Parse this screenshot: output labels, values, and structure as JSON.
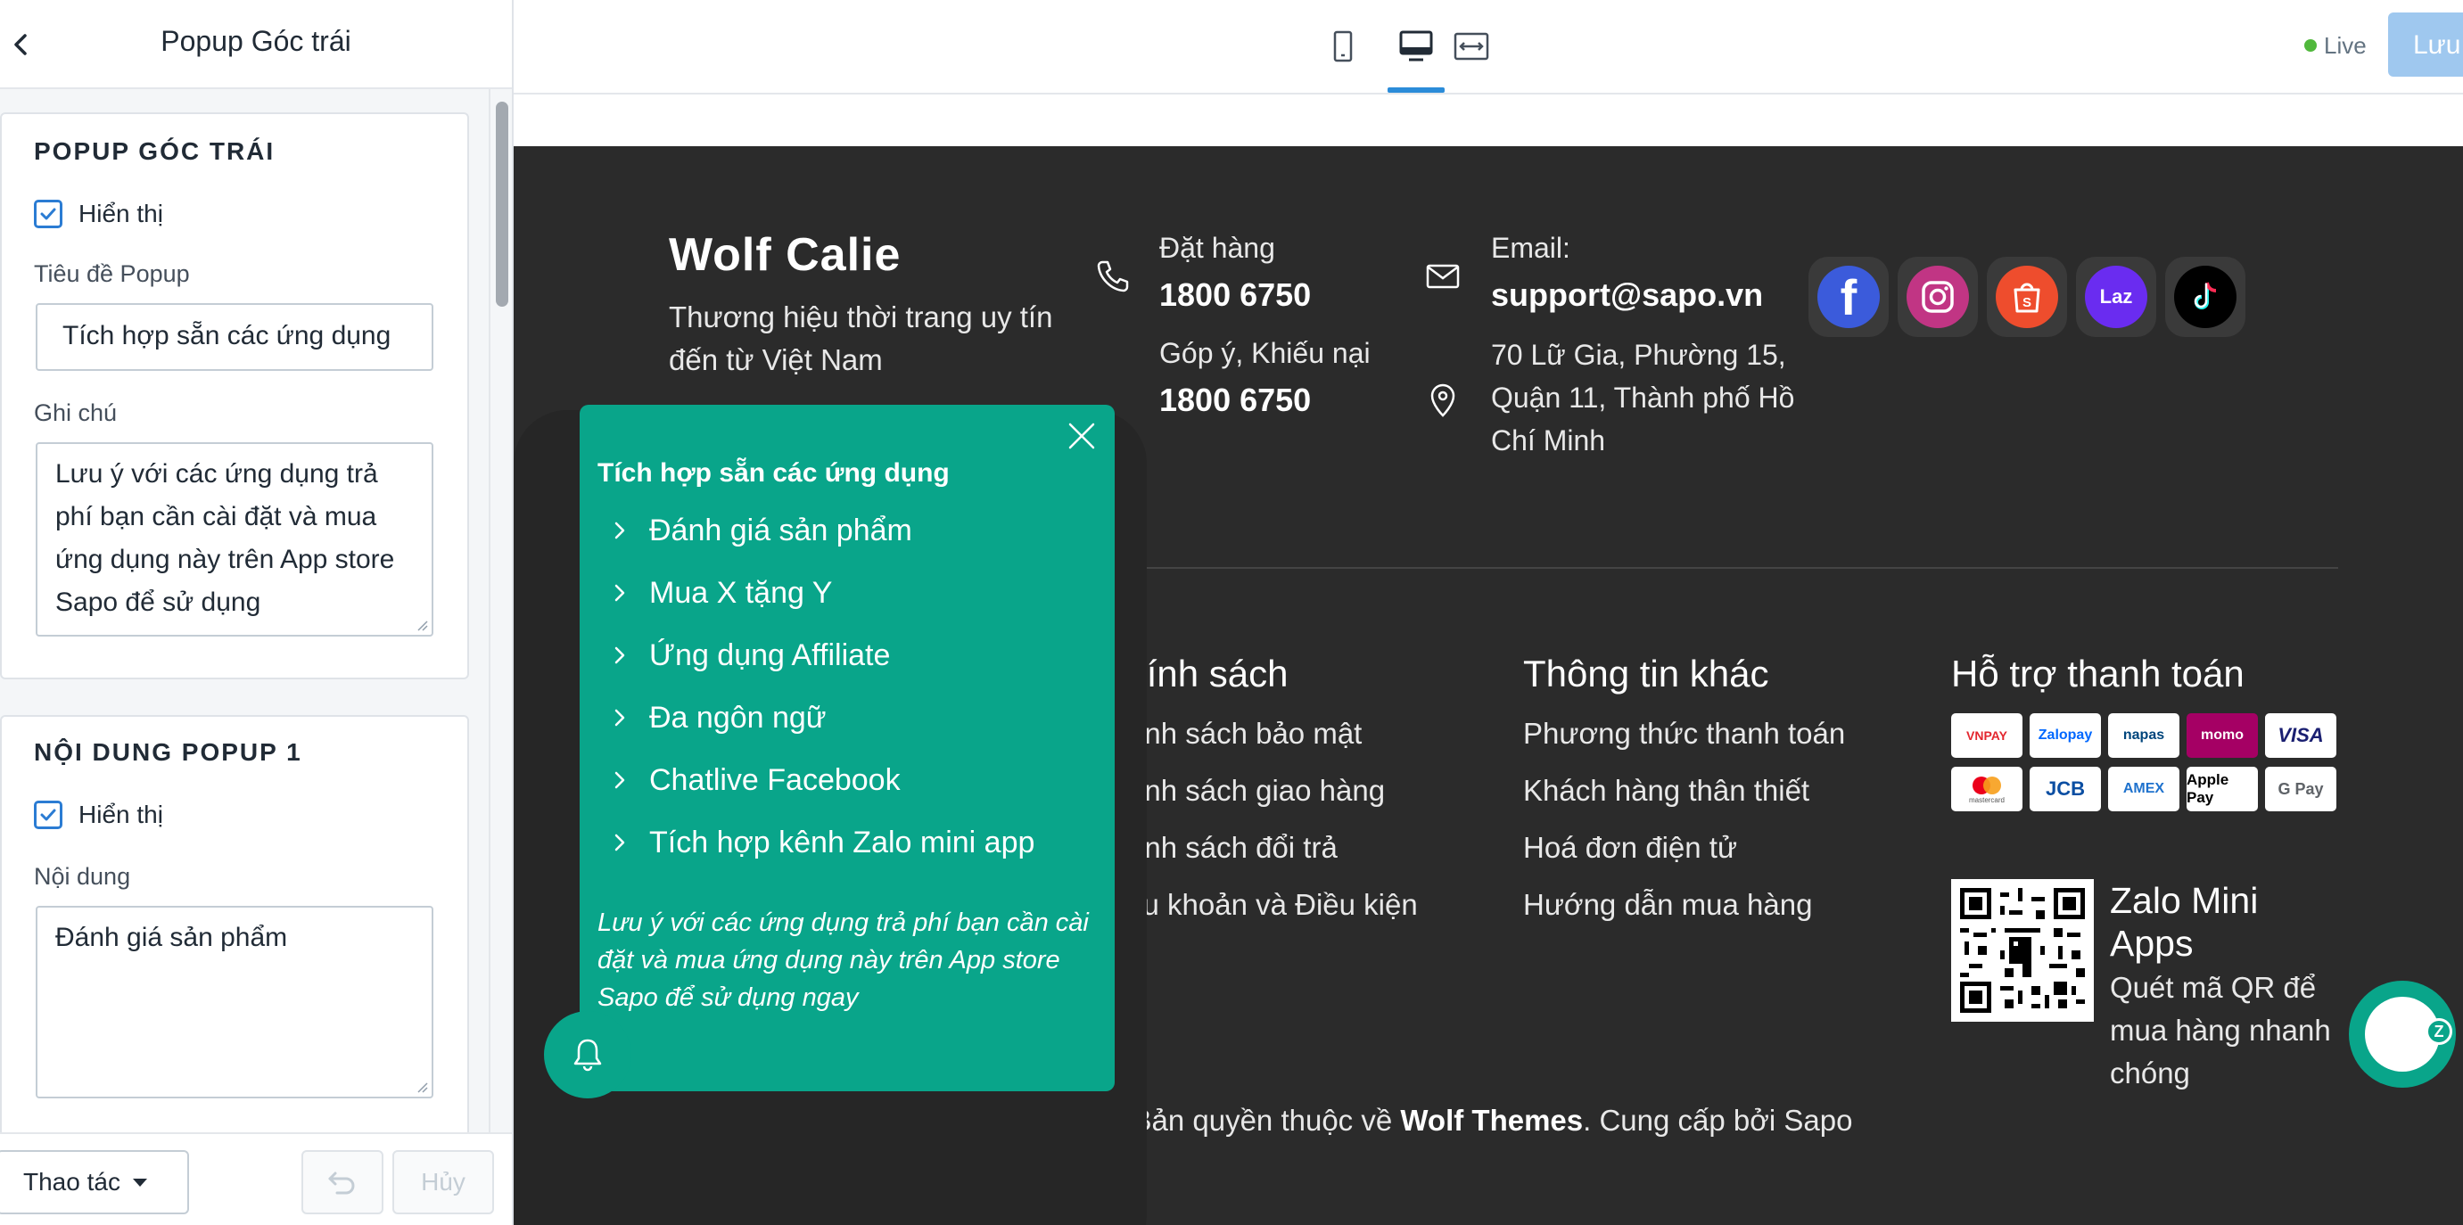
{
  "editor": {
    "title": "Popup Góc trái",
    "section1": {
      "heading": "POPUP GÓC TRÁI",
      "show_label": "Hiển thị",
      "title_label": "Tiêu đề Popup",
      "title_value": "Tích hợp sẵn các ứng dụng",
      "note_label": "Ghi chú",
      "note_value": "Lưu ý với các ứng dụng trả phí bạn cần cài đặt và mua ứng dụng này trên App store Sapo để sử dụng"
    },
    "section2": {
      "heading": "NỘI DUNG POPUP 1",
      "show_label": "Hiển thị",
      "content_label": "Nội dung",
      "content_value": "Đánh giá sản phẩm"
    },
    "footer": {
      "actions_label": "Thao tác",
      "cancel_label": "Hủy"
    }
  },
  "topbar": {
    "live_label": "Live",
    "save_label": "Lưu",
    "devices": [
      "mobile-icon",
      "desktop-icon",
      "fullwidth-icon"
    ],
    "active_device": "desktop-icon"
  },
  "site_footer": {
    "brand_name": "Wolf Calie",
    "brand_desc": "Thương hiệu thời trang uy tín đến từ Việt Nam",
    "order_label": "Đặt hàng",
    "order_phone": "1800 6750",
    "complaint_label": "Góp ý, Khiếu nại",
    "complaint_phone": "1800 6750",
    "email_label": "Email:",
    "email_value": "support@sapo.vn",
    "address": "70 Lữ Gia, Phường 15, Quận 11, Thành phố Hồ Chí Minh",
    "social": [
      "Facebook",
      "Instagram",
      "Shopee",
      "Lazada",
      "TikTok"
    ],
    "col_policy": {
      "title": "Chính sách",
      "links": [
        "Chính sách bảo mật",
        "Chính sách giao hàng",
        "Chính sách đổi trả",
        "Điều khoản và Điều kiện"
      ]
    },
    "col_info": {
      "title": "Thông tin khác",
      "links": [
        "Phương thức thanh toán",
        "Khách hàng thân thiết",
        "Hoá đơn điện tử",
        "Hướng dẫn mua hàng"
      ]
    },
    "col_payment": {
      "title": "Hỗ trợ thanh toán",
      "methods": [
        "VNPAY",
        "Zalopay",
        "napas",
        "momo",
        "VISA",
        "mastercard",
        "JCB",
        "AMEX",
        "Apple Pay",
        "G Pay"
      ]
    },
    "zalo_title": "Zalo Mini Apps",
    "zalo_desc": "Quét mã QR để mua hàng nhanh chóng",
    "copyright_prefix": "© Bản quyền thuộc về ",
    "copyright_brand": "Wolf Themes",
    "copyright_suffix": ". Cung cấp bởi Sapo"
  },
  "popup": {
    "title": "Tích hợp sẵn các ứng dụng",
    "items": [
      "Đánh giá sản phẩm",
      "Mua X tặng Y",
      "Ứng dụng Affiliate",
      "Đa ngôn ngữ",
      "Chatlive Facebook",
      "Tích hợp kênh Zalo mini app"
    ],
    "note": "Lưu ý với các ứng dụng trả phí bạn cần cài đặt và mua ứng dụng này trên App store Sapo để sử dụng ngay"
  },
  "colors": {
    "accent": "#09a58a",
    "footer_bg": "#2b2b2b",
    "primary_btn": "#9fc8ef",
    "checkbox": "#2b7cd3"
  }
}
